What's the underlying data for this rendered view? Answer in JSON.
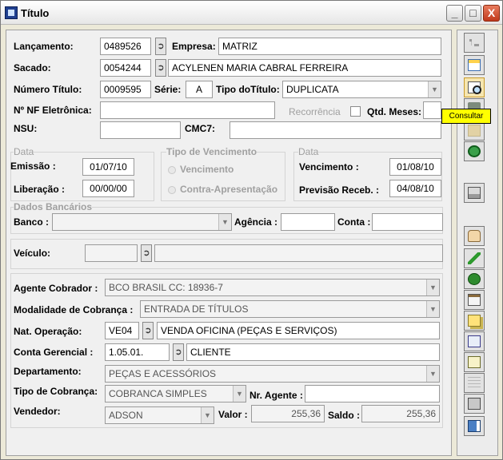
{
  "window": {
    "title": "Título",
    "buttons": {
      "minimize": "_",
      "maximize": "□",
      "close": "X"
    }
  },
  "lancamento": {
    "label": "Lançamento:",
    "value": "0489526"
  },
  "empresa": {
    "label": "Empresa:",
    "value": "MATRIZ"
  },
  "sacado": {
    "label": "Sacado:",
    "code": "0054244",
    "name": "ACYLENEN MARIA CABRAL FERREIRA"
  },
  "numero_titulo": {
    "label": "Número Título:",
    "value": "0009595"
  },
  "serie": {
    "label": "Série:",
    "value": "A"
  },
  "tipo_titulo": {
    "label": "Tipo doTítulo:",
    "value": "DUPLICATA"
  },
  "nf_eletronica": {
    "label": "Nº NF Eletrônica:",
    "value": ""
  },
  "recorrencia": {
    "label": "Recorrência",
    "checked": false
  },
  "qtd_meses": {
    "label": "Qtd. Meses:",
    "value": ""
  },
  "nsu": {
    "label": "NSU:",
    "value": ""
  },
  "cmc7": {
    "label": "CMC7:",
    "value": ""
  },
  "data_left": {
    "title": "Data",
    "emissao_label": "Emissão :",
    "emissao": "01/07/10",
    "liberacao_label": "Liberação :",
    "liberacao": "00/00/00"
  },
  "tipo_vencimento": {
    "title": "Tipo de Vencimento",
    "opt1": "Vencimento",
    "opt2": "Contra-Apresentação"
  },
  "data_right": {
    "title": "Data",
    "vencimento_label": "Vencimento :",
    "vencimento": "01/08/10",
    "previsao_label": "Previsão Receb. :",
    "previsao": "04/08/10"
  },
  "dados_bancarios": {
    "title": "Dados Bancários",
    "banco_label": "Banco :",
    "banco": "",
    "agencia_label": "Agência :",
    "agencia": "",
    "conta_label": "Conta :",
    "conta": ""
  },
  "veiculo": {
    "label": "Veículo:",
    "code": "",
    "desc": ""
  },
  "agente_cobrador": {
    "label": "Agente Cobrador :",
    "value": "BCO BRASIL CC: 18936-7"
  },
  "modalidade": {
    "label": "Modalidade de Cobrança :",
    "value": "ENTRADA DE TÍTULOS"
  },
  "nat_operacao": {
    "label": "Nat. Operação:",
    "code": "VE04",
    "desc": "VENDA OFICINA (PEÇAS E SERVIÇOS)"
  },
  "conta_gerencial": {
    "label": "Conta Gerencial :",
    "code": "1.05.01.",
    "desc": "CLIENTE"
  },
  "departamento": {
    "label": "Departamento:",
    "value": "PEÇAS E ACESSÓRIOS"
  },
  "tipo_cobranca": {
    "label": "Tipo de Cobrança:",
    "value": "COBRANCA SIMPLES"
  },
  "nr_agente": {
    "label": "Nr. Agente :",
    "value": ""
  },
  "vendedor": {
    "label": "Vendedor:",
    "value": "ADSON"
  },
  "valor": {
    "label": "Valor :",
    "value": "255,36"
  },
  "saldo": {
    "label": "Saldo :",
    "value": "255,36"
  },
  "tooltip": {
    "text": "Consultar"
  },
  "sidebar": {
    "icons": [
      "tree-icon",
      "grid-icon",
      "consult-icon",
      "trash-icon",
      "folder-icon",
      "refresh-icon",
      "print-icon",
      "thumb-icon",
      "check-icon",
      "money-icon",
      "clipboard-icon",
      "copy-icon",
      "find-icon",
      "calc-icon",
      "list-icon",
      "save-icon",
      "exit-icon"
    ]
  },
  "colors": {
    "tooltip": "#ffff00",
    "close_button": "#c0391b",
    "window_bg": "#ece9d8"
  }
}
